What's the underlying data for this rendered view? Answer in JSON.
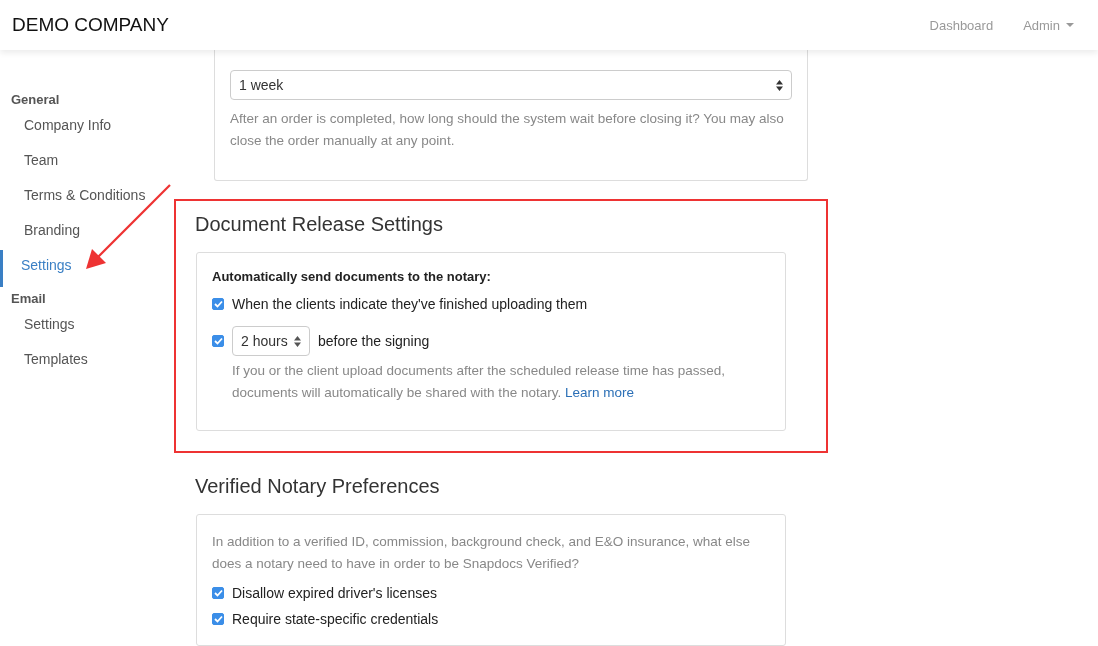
{
  "header": {
    "brand": "DEMO COMPANY",
    "nav": [
      {
        "label": "Dashboard",
        "kind": "link"
      },
      {
        "label": "Admin",
        "kind": "dropdown"
      }
    ]
  },
  "sidebar": {
    "groups": [
      {
        "heading": "General",
        "items": [
          {
            "label": "Company Info",
            "selected": false
          },
          {
            "label": "Team",
            "selected": false
          },
          {
            "label": "Terms & Conditions",
            "selected": false
          },
          {
            "label": "Branding",
            "selected": false
          },
          {
            "label": "Settings",
            "selected": true
          }
        ]
      },
      {
        "heading": "Email",
        "items": [
          {
            "label": "Settings",
            "selected": false
          },
          {
            "label": "Templates",
            "selected": false
          }
        ]
      }
    ]
  },
  "auto_close": {
    "value": "1 week",
    "help": "After an order is completed, how long should the system wait before closing it? You may also close the order manually at any point."
  },
  "document_release": {
    "title": "Document Release Settings",
    "highlighted": true,
    "heading": "Automatically send documents to the notary:",
    "options": [
      {
        "kind": "checkbox",
        "checked": true,
        "label": "When the clients indicate they've finished uploading them"
      },
      {
        "kind": "timed",
        "checked": true,
        "select_value": "2 hours",
        "label": "before the signing",
        "help": "If you or the client upload documents after the scheduled release time has passed, documents will automatically be shared with the notary.",
        "link": "Learn more"
      }
    ]
  },
  "verified_notary": {
    "title": "Verified Notary Preferences",
    "intro": "In addition to a verified ID, commission, background check, and E&O insurance, what else does a notary need to have in order to be Snapdocs Verified?",
    "options": [
      {
        "label": "Disallow expired driver's licenses",
        "checked": true
      },
      {
        "label": "Require state-specific credentials",
        "checked": true
      }
    ]
  }
}
